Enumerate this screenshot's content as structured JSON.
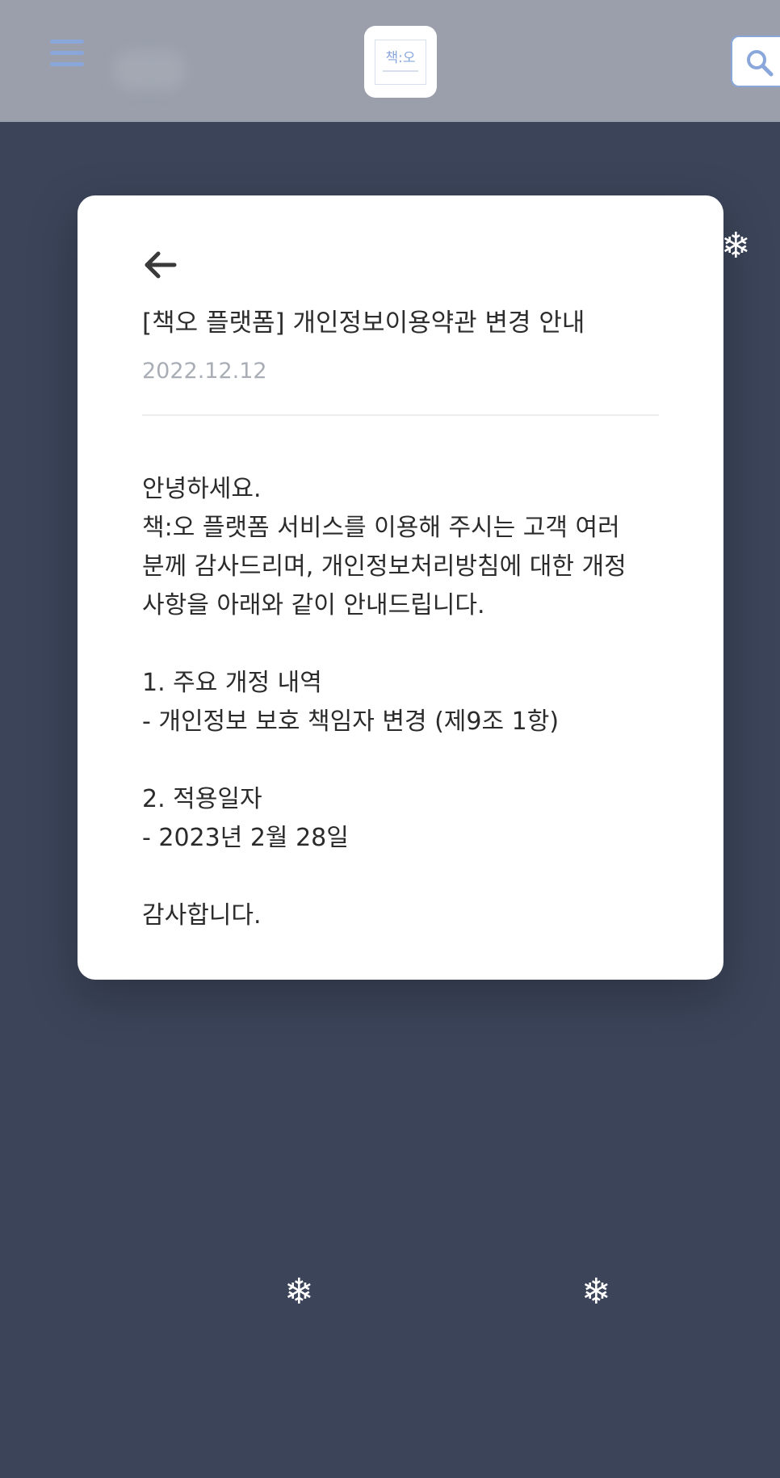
{
  "header": {
    "logo_text": "책:오",
    "menu_icon": "hamburger-menu-icon",
    "search_icon": "search-icon"
  },
  "notice": {
    "title": "[책오 플랫폼] 개인정보이용약관 변경 안내",
    "date": "2022.12.12",
    "body_lines": [
      "안녕하세요.",
      "책:오 플랫폼 서비스를 이용해 주시는 고객 여러",
      "분께 감사드리며, 개인정보처리방침에 대한 개정",
      "사항을 아래와 같이 안내드립니다.",
      "",
      "1. 주요 개정 내역",
      "- 개인정보 보호 책임자 변경 (제9조 1항)",
      "",
      "2. 적용일자",
      "- 2023년 2월 28일",
      "",
      "감사합니다."
    ]
  },
  "decorations": {
    "snowflake": "❄"
  },
  "colors": {
    "background": "#3b4459",
    "header": "#9a9fab",
    "accent": "#8aa7dc",
    "date": "#a9aeb6"
  }
}
